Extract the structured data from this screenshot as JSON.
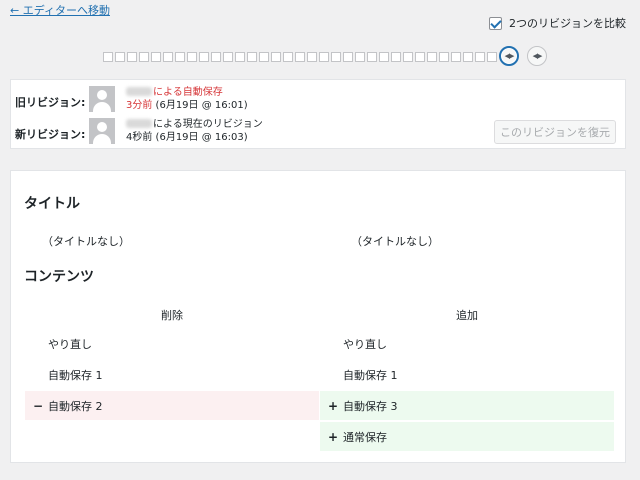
{
  "nav": {
    "back_label": "← エディターへ移動"
  },
  "compare": {
    "label": "2つのリビジョンを比較",
    "checked": true
  },
  "slider": {
    "tick_count": 33
  },
  "revisions": {
    "old": {
      "label": "旧リビジョン:",
      "author_text": "による自動保存",
      "ago": "3分前",
      "date": " (6月19日 @ 16:01)"
    },
    "new": {
      "label": "新リビジョン:",
      "author_text": "による現在のリビジョン",
      "ago": "4秒前",
      "date": " (6月19日 @ 16:03)"
    },
    "restore_label": "このリビジョンを復元"
  },
  "diff": {
    "title_heading": "タイトル",
    "title_left": "（タイトルなし）",
    "title_right": "（タイトルなし）",
    "content_heading": "コンテンツ",
    "removed_header": "削除",
    "added_header": "追加",
    "rows": {
      "left_1": "やり直し",
      "left_2": "自動保存 1",
      "left_3": "自動保存 2",
      "right_1": "やり直し",
      "right_2": "自動保存 1",
      "right_3": "自動保存 3",
      "right_4": "通常保存"
    },
    "minus_mark": "−",
    "plus_mark": "+"
  },
  "colors": {
    "link": "#2271b1",
    "deleted_bg": "#fcf0f1",
    "added_bg": "#edfaef",
    "old_text": "#d63638"
  }
}
